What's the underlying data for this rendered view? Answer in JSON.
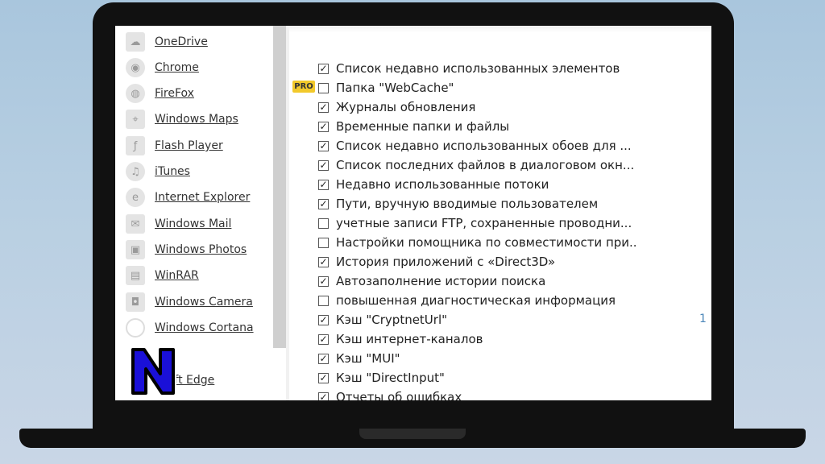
{
  "sidebar": {
    "items": [
      {
        "label": "OneDrive",
        "icon": "cloud-icon"
      },
      {
        "label": "Chrome",
        "icon": "chrome-icon"
      },
      {
        "label": "FireFox",
        "icon": "firefox-icon"
      },
      {
        "label": "Windows Maps",
        "icon": "map-icon"
      },
      {
        "label": "Flash Player",
        "icon": "flash-icon"
      },
      {
        "label": "iTunes",
        "icon": "music-icon"
      },
      {
        "label": "Internet Explorer",
        "icon": "ie-icon"
      },
      {
        "label": "Windows Mail",
        "icon": "mail-icon"
      },
      {
        "label": "Windows Photos",
        "icon": "photos-icon"
      },
      {
        "label": "WinRAR",
        "icon": "archive-icon"
      },
      {
        "label": "Windows Camera",
        "icon": "camera-icon"
      },
      {
        "label": "Windows Cortana",
        "icon": "cortana-icon"
      },
      {
        "label": "osoft Edge",
        "icon": "edge-icon"
      }
    ]
  },
  "pro_badge": "PRO",
  "checklist": [
    {
      "label": "Список недавно использованных элементов",
      "checked": true
    },
    {
      "label": "Папка \"WebCache\"",
      "checked": false
    },
    {
      "label": "Журналы обновления",
      "checked": true
    },
    {
      "label": "Временные папки и файлы",
      "checked": true
    },
    {
      "label": "Список недавно использованных обоев для ...",
      "checked": true
    },
    {
      "label": "Список последних файлов в диалоговом окн...",
      "checked": true
    },
    {
      "label": "Недавно использованные потоки",
      "checked": true
    },
    {
      "label": "Пути, вручную вводимые пользователем",
      "checked": true
    },
    {
      "label": "учетные записи FTP, сохраненные проводни...",
      "checked": false
    },
    {
      "label": "Настройки помощника по совместимости при..",
      "checked": false
    },
    {
      "label": "История приложений с «Direct3D»",
      "checked": true
    },
    {
      "label": "Автозаполнение истории поиска",
      "checked": true
    },
    {
      "label": "повышенная диагностическая информация",
      "checked": false
    },
    {
      "label": "Кэш \"CryptnetUrl\"",
      "checked": true
    },
    {
      "label": "Кэш интернет-каналов",
      "checked": true
    },
    {
      "label": "Кэш \"MUI\"",
      "checked": true
    },
    {
      "label": "Кэш \"DirectInput\"",
      "checked": true
    },
    {
      "label": "Отчеты об ошибках",
      "checked": true
    }
  ],
  "right_number": "1",
  "colors": {
    "background": "#b8cfe2",
    "laptop": "#111111",
    "pro_badge": "#f2c92b",
    "logo_fill": "#1a10d8"
  }
}
